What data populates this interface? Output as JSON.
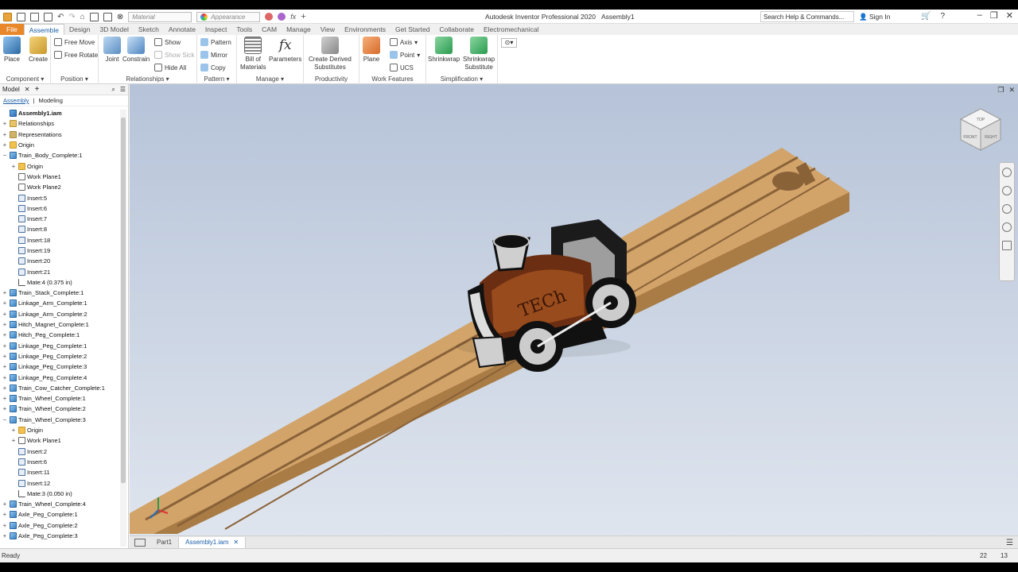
{
  "window": {
    "title": "Autodesk Inventor Professional 2020",
    "document": "Assembly1",
    "search_placeholder": "Search Help & Commands...",
    "sign_in": "Sign In"
  },
  "quick_access": {
    "material": "Material",
    "appearance": "Appearance"
  },
  "tabs": [
    "File",
    "Assemble",
    "Design",
    "3D Model",
    "Sketch",
    "Annotate",
    "Inspect",
    "Tools",
    "CAM",
    "Manage",
    "View",
    "Environments",
    "Get Started",
    "Collaborate",
    "Electromechanical"
  ],
  "ribbon": {
    "component": {
      "label": "Component",
      "place": "Place",
      "create": "Create"
    },
    "position": {
      "label": "Position",
      "free_move": "Free Move",
      "free_rotate": "Free Rotate"
    },
    "relationships": {
      "label": "Relationships",
      "joint": "Joint",
      "constrain": "Constrain",
      "show": "Show",
      "show_sick": "Show Sick",
      "hide_all": "Hide All"
    },
    "pattern": {
      "label": "Pattern",
      "pattern": "Pattern",
      "mirror": "Mirror",
      "copy": "Copy"
    },
    "manage": {
      "label": "Manage",
      "bom_line1": "Bill of",
      "bom_line2": "Materials",
      "parameters": "Parameters"
    },
    "productivity": {
      "label": "Productivity",
      "line1": "Create Derived",
      "line2": "Substitutes"
    },
    "work_features": {
      "label": "Work Features",
      "plane": "Plane",
      "axis": "Axis",
      "point": "Point",
      "ucs": "UCS"
    },
    "simplification": {
      "label": "Simplification",
      "shrinkwrap": "Shrinkwrap",
      "sws_line1": "Shrinkwrap",
      "sws_line2": "Substitute"
    }
  },
  "browser": {
    "title": "Model",
    "sub_assembly": "Assembly",
    "sub_modeling": "Modeling",
    "tree": [
      {
        "label": "Assembly1.iam",
        "icon": "asm",
        "level": 0,
        "toggle": "",
        "bold": true
      },
      {
        "label": "Relationships",
        "icon": "rel",
        "level": 0,
        "toggle": "+"
      },
      {
        "label": "Representations",
        "icon": "rep",
        "level": 0,
        "toggle": "+"
      },
      {
        "label": "Origin",
        "icon": "folder",
        "level": 0,
        "toggle": "+"
      },
      {
        "label": "Train_Body_Complete:1",
        "icon": "part",
        "level": 0,
        "toggle": "−"
      },
      {
        "label": "Origin",
        "icon": "folder",
        "level": 1,
        "toggle": "+"
      },
      {
        "label": "Work Plane1",
        "icon": "plane",
        "level": 1,
        "toggle": ""
      },
      {
        "label": "Work Plane2",
        "icon": "plane",
        "level": 1,
        "toggle": ""
      },
      {
        "label": "Insert:5",
        "icon": "insert",
        "level": 1,
        "toggle": ""
      },
      {
        "label": "Insert:6",
        "icon": "insert",
        "level": 1,
        "toggle": ""
      },
      {
        "label": "Insert:7",
        "icon": "insert",
        "level": 1,
        "toggle": ""
      },
      {
        "label": "Insert:8",
        "icon": "insert",
        "level": 1,
        "toggle": ""
      },
      {
        "label": "Insert:18",
        "icon": "insert",
        "level": 1,
        "toggle": ""
      },
      {
        "label": "Insert:19",
        "icon": "insert",
        "level": 1,
        "toggle": ""
      },
      {
        "label": "Insert:20",
        "icon": "insert",
        "level": 1,
        "toggle": ""
      },
      {
        "label": "Insert:21",
        "icon": "insert",
        "level": 1,
        "toggle": ""
      },
      {
        "label": "Mate:4 (0.375 in)",
        "icon": "mate",
        "level": 1,
        "toggle": ""
      },
      {
        "label": "Train_Stack_Complete:1",
        "icon": "part",
        "level": 0,
        "toggle": "+"
      },
      {
        "label": "Linkage_Arm_Complete:1",
        "icon": "part",
        "level": 0,
        "toggle": "+"
      },
      {
        "label": "Linkage_Arm_Complete:2",
        "icon": "part",
        "level": 0,
        "toggle": "+"
      },
      {
        "label": "Hitch_Magnet_Complete:1",
        "icon": "part",
        "level": 0,
        "toggle": "+"
      },
      {
        "label": "Hitch_Peg_Complete:1",
        "icon": "part",
        "level": 0,
        "toggle": "+"
      },
      {
        "label": "Linkage_Peg_Complete:1",
        "icon": "part",
        "level": 0,
        "toggle": "+"
      },
      {
        "label": "Linkage_Peg_Complete:2",
        "icon": "part",
        "level": 0,
        "toggle": "+"
      },
      {
        "label": "Linkage_Peg_Complete:3",
        "icon": "part",
        "level": 0,
        "toggle": "+"
      },
      {
        "label": "Linkage_Peg_Complete:4",
        "icon": "part",
        "level": 0,
        "toggle": "+"
      },
      {
        "label": "Train_Cow_Catcher_Complete:1",
        "icon": "part",
        "level": 0,
        "toggle": "+"
      },
      {
        "label": "Train_Wheel_Complete:1",
        "icon": "part",
        "level": 0,
        "toggle": "+"
      },
      {
        "label": "Train_Wheel_Complete:2",
        "icon": "part",
        "level": 0,
        "toggle": "+"
      },
      {
        "label": "Train_Wheel_Complete:3",
        "icon": "part",
        "level": 0,
        "toggle": "−"
      },
      {
        "label": "Origin",
        "icon": "folder",
        "level": 1,
        "toggle": "+"
      },
      {
        "label": "Work Plane1",
        "icon": "plane",
        "level": 1,
        "toggle": "+"
      },
      {
        "label": "Insert:2",
        "icon": "insert",
        "level": 1,
        "toggle": ""
      },
      {
        "label": "Insert:6",
        "icon": "insert",
        "level": 1,
        "toggle": ""
      },
      {
        "label": "Insert:11",
        "icon": "insert",
        "level": 1,
        "toggle": ""
      },
      {
        "label": "Insert:12",
        "icon": "insert",
        "level": 1,
        "toggle": ""
      },
      {
        "label": "Mate:3 (0.050 in)",
        "icon": "mate",
        "level": 1,
        "toggle": ""
      },
      {
        "label": "Train_Wheel_Complete:4",
        "icon": "part",
        "level": 0,
        "toggle": "+"
      },
      {
        "label": "Axle_Peg_Complete:1",
        "icon": "part",
        "level": 0,
        "toggle": "+"
      },
      {
        "label": "Axle_Peg_Complete:2",
        "icon": "part",
        "level": 0,
        "toggle": "+"
      },
      {
        "label": "Axle_Peg_Complete:3",
        "icon": "part",
        "level": 0,
        "toggle": "+"
      }
    ]
  },
  "viewport": {
    "train_lettering": "TECh",
    "viewcube_top": "TOP",
    "viewcube_front": "FRONT",
    "viewcube_right": "RIGHT"
  },
  "doc_tabs": [
    "Part1",
    "Assembly1.iam"
  ],
  "status": {
    "text": "Ready",
    "n1": "22",
    "n2": "13"
  },
  "colors": {
    "file_tab": "#e9882b",
    "accent": "#1a5da6",
    "wood": "#c99a5e",
    "viewport_top": "#b6c3d8"
  }
}
